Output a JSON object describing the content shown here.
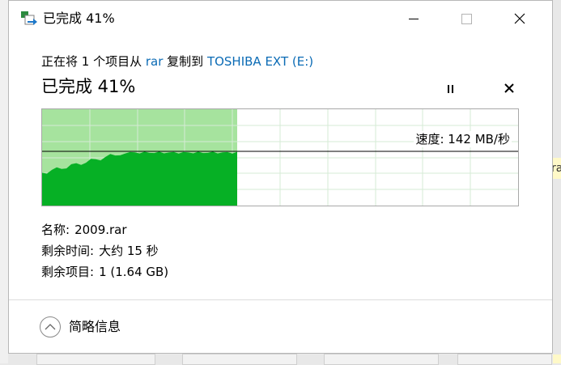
{
  "dialog": {
    "title": "已完成 41%",
    "window_controls": {
      "minimize_icon": "minimize-icon",
      "maximize_icon": "maximize-icon",
      "close_icon": "close-icon"
    }
  },
  "copy_line": {
    "prefix": "正在将 1 个项目从 ",
    "source": "rar",
    "middle": " 复制到 ",
    "destination": "TOSHIBA EXT (E:)"
  },
  "progress": {
    "title": "已完成 41%",
    "percent": 41
  },
  "controls": {
    "pause_icon": "pause-icon",
    "cancel_icon": "cancel-icon"
  },
  "graph": {
    "speed_label": "速度: 142 MB/秒",
    "progress_fraction": 0.41
  },
  "info": {
    "name_key": "名称:",
    "name_value": "2009.rar",
    "time_key": "剩余时间:",
    "time_value": "大约 15 秒",
    "items_key": "剩余项目:",
    "items_value": "1 (1.64 GB)"
  },
  "footer": {
    "details_label": "简略信息",
    "details_icon": "chevron-up-icon"
  },
  "background": {
    "right_edge_text": "ra"
  },
  "colors": {
    "graph_fill": "#06b025",
    "graph_light": "#a6e39e",
    "grid": "#d6ebd6",
    "link": "#0b6bb5"
  }
}
